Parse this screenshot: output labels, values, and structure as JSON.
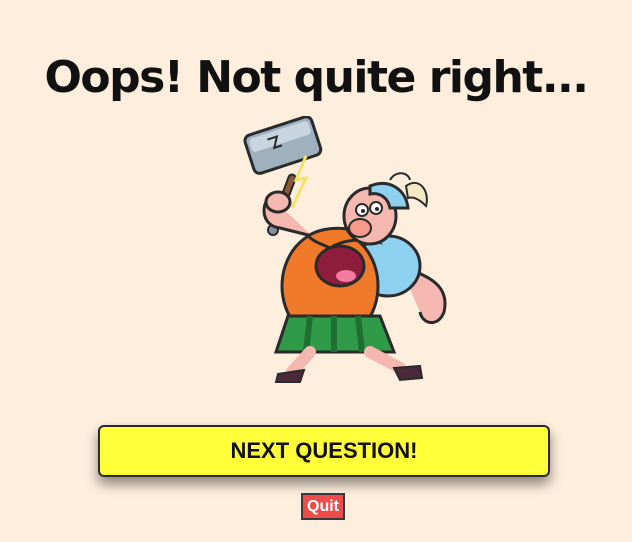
{
  "result": {
    "title": "Oops! Not quite right..."
  },
  "mascot": {
    "icon": "viking-with-hammer-icon"
  },
  "actions": {
    "next_label": "NEXT QUESTION!",
    "quit_label": "Quit"
  },
  "colors": {
    "background": "#fdeedd",
    "next_button": "#ffff3a",
    "quit_button": "#ef4b4b"
  }
}
